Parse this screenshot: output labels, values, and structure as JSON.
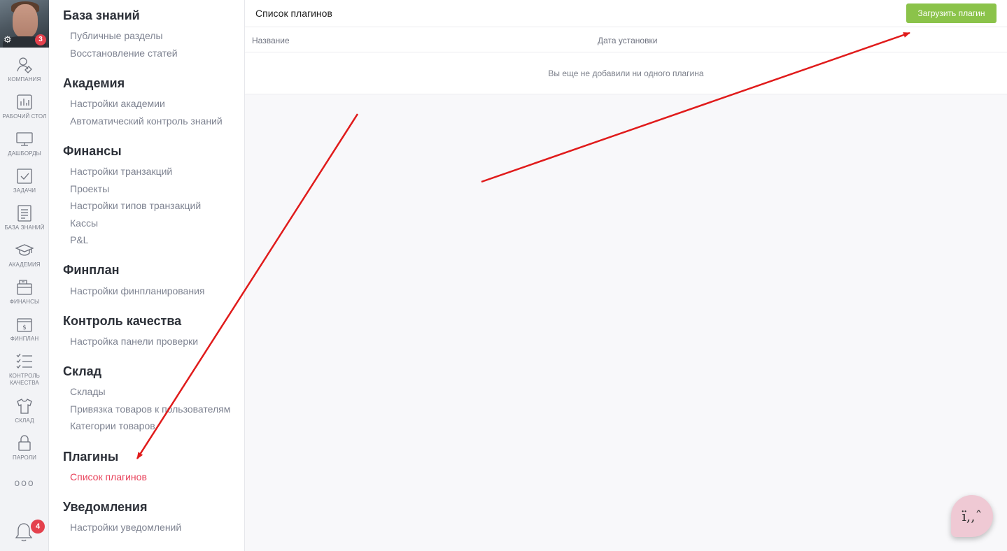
{
  "rail": {
    "avatar_badge": "3",
    "items": [
      {
        "label": "КОМПАНИЯ"
      },
      {
        "label": "РАБОЧИЙ СТОЛ"
      },
      {
        "label": "ДАШБОРДЫ"
      },
      {
        "label": "ЗАДАЧИ"
      },
      {
        "label": "БАЗА ЗНАНИЙ"
      },
      {
        "label": "АКАДЕМИЯ"
      },
      {
        "label": "ФИНАНСЫ"
      },
      {
        "label": "ФИНПЛАН"
      },
      {
        "label": "КОНТРОЛЬ КАЧЕСТВА"
      },
      {
        "label": "СКЛАД"
      },
      {
        "label": "ПАРОЛИ"
      }
    ],
    "more": "ooo",
    "notifications_badge": "4"
  },
  "settings": {
    "sections": [
      {
        "title": "База знаний",
        "links": [
          "Публичные разделы",
          "Восстановление статей"
        ]
      },
      {
        "title": "Академия",
        "links": [
          "Настройки академии",
          "Автоматический контроль знаний"
        ]
      },
      {
        "title": "Финансы",
        "links": [
          "Настройки транзакций",
          "Проекты",
          "Настройки типов транзакций",
          "Кассы",
          "P&L"
        ]
      },
      {
        "title": "Финплан",
        "links": [
          "Настройки финпланирования"
        ]
      },
      {
        "title": "Контроль качества",
        "links": [
          "Настройка панели проверки"
        ]
      },
      {
        "title": "Склад",
        "links": [
          "Склады",
          "Привязка товаров к пользователям",
          "Категории товаров"
        ]
      },
      {
        "title": "Плагины",
        "links": [
          "Список плагинов"
        ]
      },
      {
        "title": "Уведомления",
        "links": [
          "Настройки уведомлений"
        ]
      }
    ],
    "active_link": "Список плагинов"
  },
  "main": {
    "title": "Список плагинов",
    "upload_button": "Загрузить плагин",
    "columns": [
      "Название",
      "Дата установки"
    ],
    "empty_message": "Вы еще не добавили ни одного плагина"
  },
  "chat": {
    "glyph": "ї,,ˆ"
  },
  "colors": {
    "accent_green": "#8bc34a",
    "active_link": "#e8415a",
    "badge": "#e4414d",
    "annotation_arrow": "#e01b1b"
  }
}
